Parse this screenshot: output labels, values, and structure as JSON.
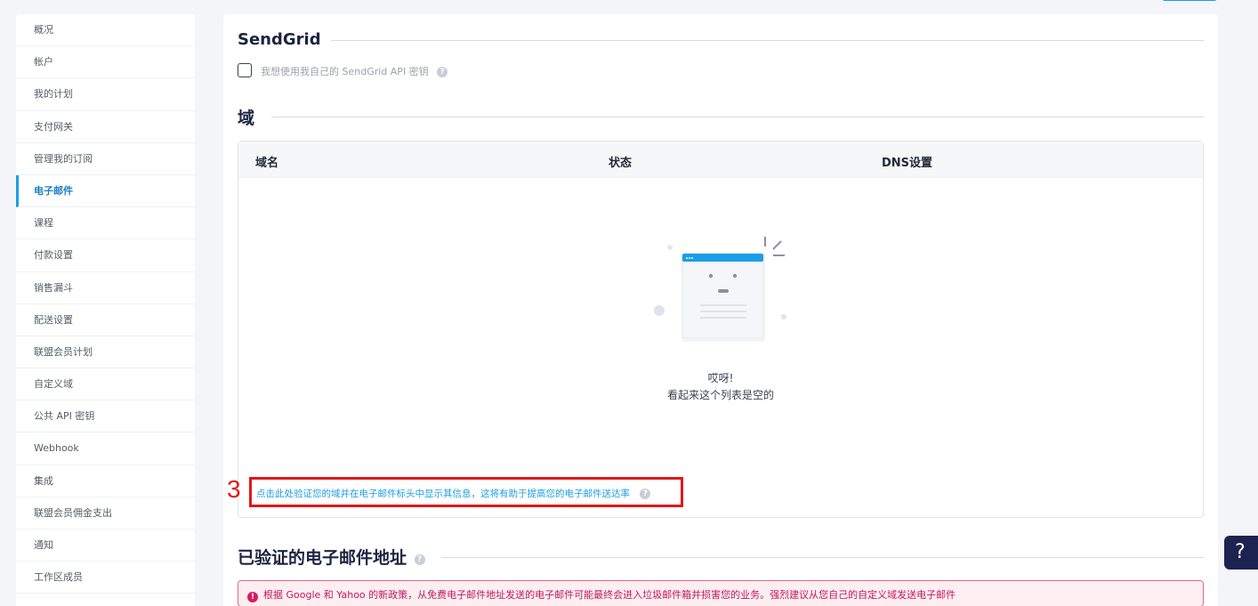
{
  "sidebar": {
    "items": [
      {
        "label": "概况"
      },
      {
        "label": "帐户"
      },
      {
        "label": "我的计划"
      },
      {
        "label": "支付网关"
      },
      {
        "label": "管理我的订阅"
      },
      {
        "label": "电子邮件",
        "active": true
      },
      {
        "label": "课程"
      },
      {
        "label": "付款设置"
      },
      {
        "label": "销售漏斗"
      },
      {
        "label": "配送设置"
      },
      {
        "label": "联盟会员计划"
      },
      {
        "label": "自定义域"
      },
      {
        "label": "公共 API 密钥"
      },
      {
        "label": "Webhook"
      },
      {
        "label": "集成"
      },
      {
        "label": "联盟会员佣金支出"
      },
      {
        "label": "通知"
      },
      {
        "label": "工作区成员"
      }
    ]
  },
  "sendgrid": {
    "title": "SendGrid",
    "checkbox_label": "我想使用我自己的 SendGrid API 密钥",
    "checked": false
  },
  "domains": {
    "title": "域",
    "columns": [
      "域名",
      "状态",
      "DNS设置"
    ],
    "empty_title": "哎呀!",
    "empty_subtitle": "看起来这个列表是空的",
    "verify_link": "点击此处验证您的域并在电子邮件标头中显示其信息，这将有助于提高您的电子邮件送达率",
    "annotation_number": "3"
  },
  "verified": {
    "title": "已验证的电子邮件地址",
    "alert": "根据 Google 和 Yahoo 的新政策，从免费电子邮件地址发送的电子邮件可能最终会进入垃圾邮件箱并损害您的业务。强烈建议从您自己的自定义域发送电子邮件"
  },
  "help": {
    "label": "?"
  },
  "icons": {
    "question": "question-circle-icon",
    "alert": "exclamation-circle-icon"
  },
  "colors": {
    "accent": "#1a9de8",
    "annotation": "#e01818",
    "alert_text": "#c2185b",
    "help_bg": "#1c2350"
  }
}
